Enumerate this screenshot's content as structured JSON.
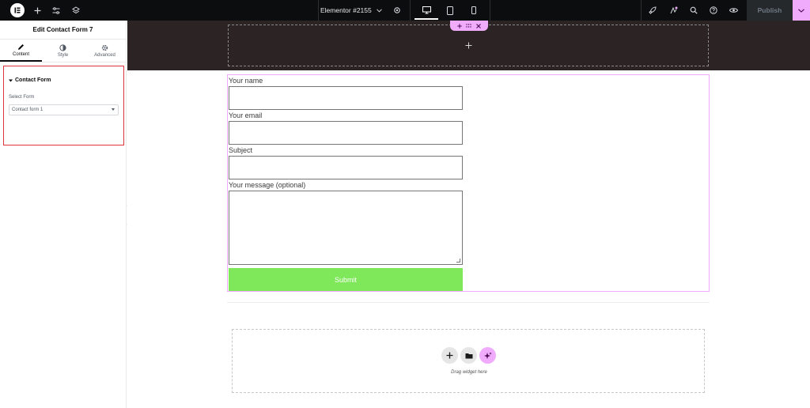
{
  "topbar": {
    "document_title": "Elementor #2155",
    "publish_label": "Publish",
    "accent_color": "#f0abfc",
    "icons": [
      "elementor-logo-icon",
      "add-icon",
      "settings-sliders-icon",
      "layers-icon",
      "chevron-down-icon",
      "gear-icon",
      "desktop-icon",
      "tablet-icon",
      "mobile-icon",
      "rocket-icon",
      "notes-icon",
      "search-icon",
      "help-icon",
      "preview-eye-icon",
      "caret-down-icon"
    ]
  },
  "panel": {
    "title": "Edit Contact Form 7",
    "tabs": [
      {
        "label": "Content",
        "icon": "pencil-icon",
        "active": true
      },
      {
        "label": "Style",
        "icon": "contrast-icon",
        "active": false
      },
      {
        "label": "Advanced",
        "icon": "gear-icon",
        "active": false
      }
    ],
    "section_title": "Contact Form",
    "select_label": "Select Form",
    "select_value": "Contact form 1"
  },
  "form": {
    "name_label": "Your name",
    "email_label": "Your email",
    "subject_label": "Subject",
    "message_label": "Your message (optional)",
    "submit_label": "Submit",
    "submit_color": "#7ee75a"
  },
  "drop_area": {
    "text": "Drag widget here"
  }
}
